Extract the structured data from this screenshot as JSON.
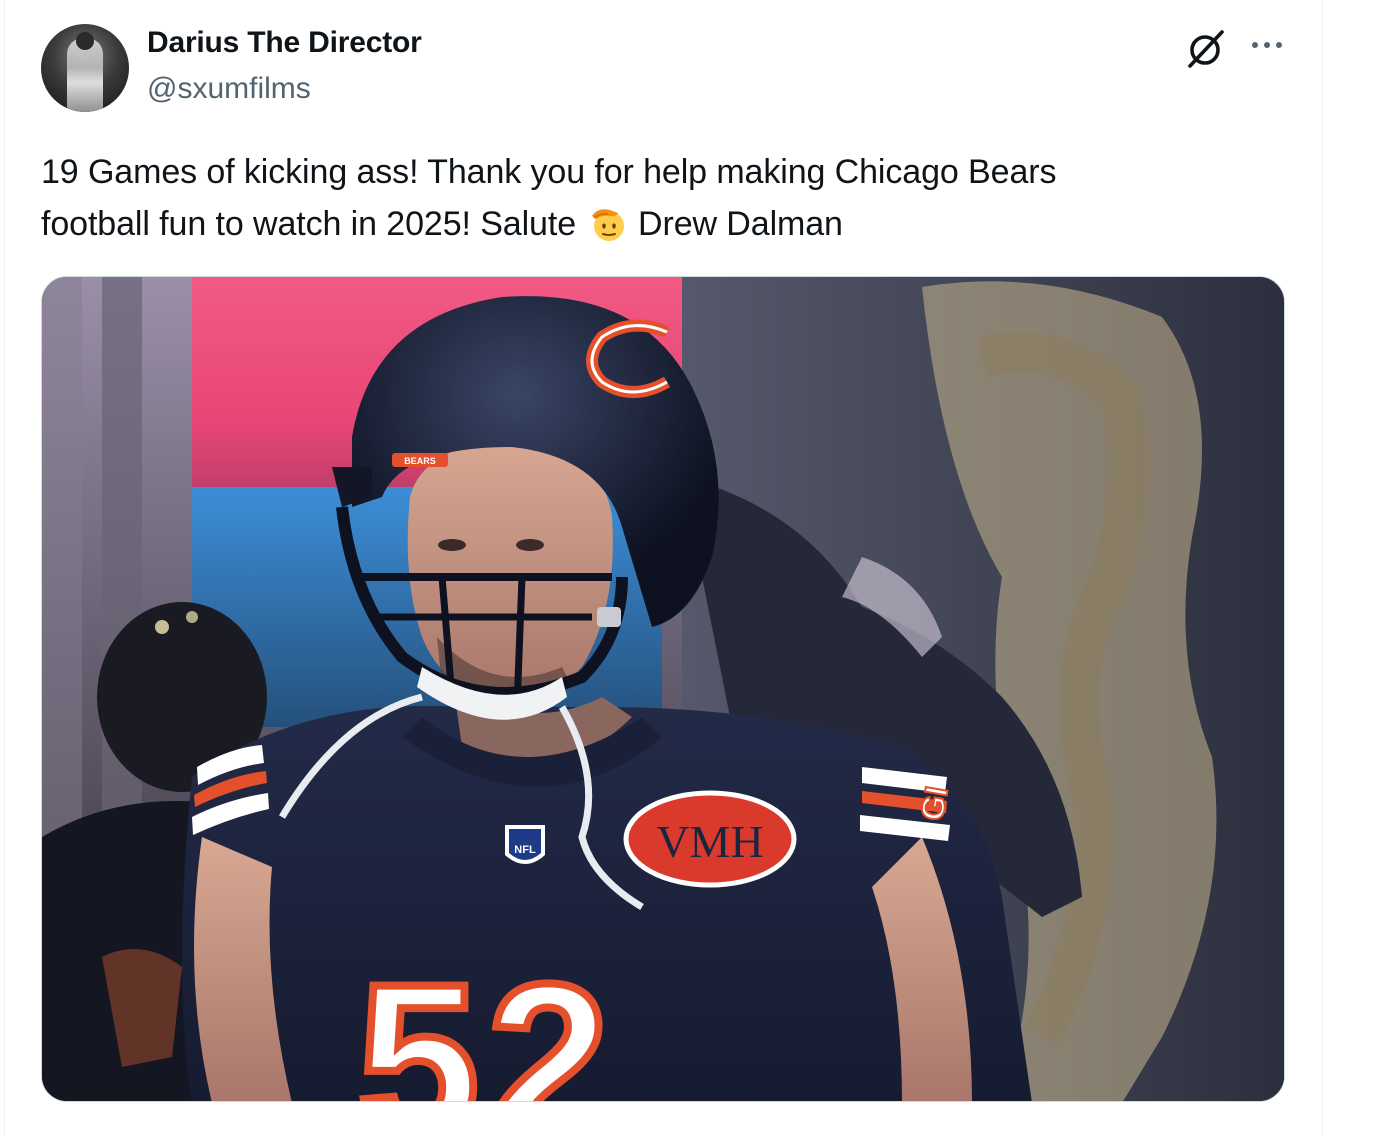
{
  "author": {
    "display_name": "Darius The Director",
    "handle": "@sxumfilms",
    "avatar_icon": "avatar-image"
  },
  "actions": {
    "grok_icon": "grok-icon",
    "more_icon": "more-icon"
  },
  "tweet": {
    "line1": "19 Games of kicking ass! Thank you for help making Chicago Bears",
    "line2_before": "football fun to watch in 2025! Salute",
    "emoji": "saluting-face-emoji",
    "line2_after": "Drew Dalman"
  },
  "media": {
    "helmet_logo": "BEARS",
    "patch_text": "VMH",
    "jersey_number": "52",
    "sleeve_number": "GI",
    "shield_text": "NFL"
  },
  "colors": {
    "text_primary": "#0f1419",
    "text_secondary": "#536471",
    "border": "#cfd9de",
    "bears_navy": "#1e2540",
    "bears_orange": "#e3502b"
  }
}
